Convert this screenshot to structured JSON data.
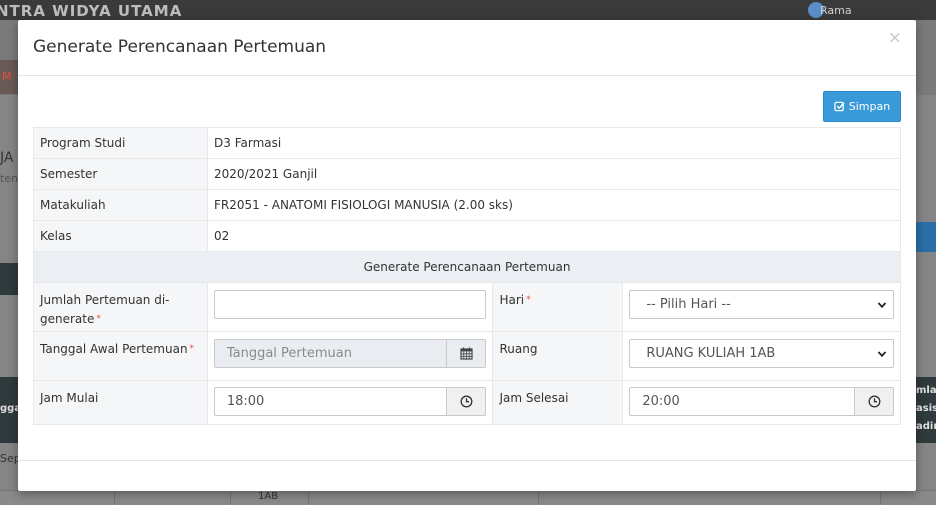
{
  "background": {
    "brand": "NTRA WIDYA UTAMA",
    "user": "Rama",
    "nav_item": "M",
    "side_text_1": "JA",
    "side_text_2": "ten",
    "side_text_3": "ggal",
    "side_text_4": "Sep",
    "right_text": "mlah\nasis\nadir",
    "bottom_cell": "1AB"
  },
  "modal": {
    "title": "Generate Perencanaan Pertemuan",
    "close_glyph": "×",
    "save_label": "Simpan"
  },
  "info": [
    {
      "label": "Program Studi",
      "value": "D3 Farmasi"
    },
    {
      "label": "Semester",
      "value": "2020/2021 Ganjil"
    },
    {
      "label": "Matakuliah",
      "value": "FR2051 - ANATOMI FISIOLOGI MANUSIA (2.00 sks)"
    },
    {
      "label": "Kelas",
      "value": "02"
    }
  ],
  "section_header": "Generate Perencanaan Pertemuan",
  "form": {
    "jumlah_label": "Jumlah Pertemuan di-generate",
    "jumlah_value": "",
    "hari_label": "Hari",
    "hari_value": "-- Pilih Hari --",
    "tanggal_label": "Tanggal Awal Pertemuan",
    "tanggal_placeholder": "Tanggal Pertemuan",
    "ruang_label": "Ruang",
    "ruang_value": "RUANG KULIAH 1AB",
    "jam_mulai_label": "Jam Mulai",
    "jam_mulai_value": "18:00",
    "jam_selesai_label": "Jam Selesai",
    "jam_selesai_value": "20:00",
    "required_mark": "*"
  },
  "icons": {
    "save": "check-square-icon",
    "calendar": "calendar-icon",
    "clock": "clock-icon",
    "dropdown": "chevron-down-icon"
  },
  "colors": {
    "primary": "#3a99d8",
    "required": "#e74c3c"
  }
}
